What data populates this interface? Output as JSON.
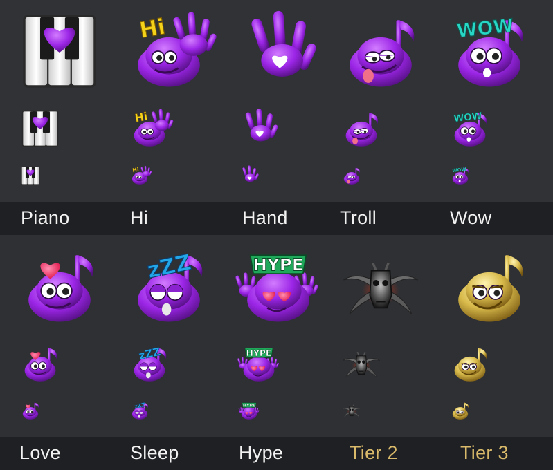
{
  "rows": [
    {
      "emotes": [
        {
          "label": "Piano",
          "icon": "piano-heart-icon",
          "tier": "standard"
        },
        {
          "label": "Hi",
          "icon": "hi-wave-icon",
          "tier": "standard"
        },
        {
          "label": "Hand",
          "icon": "hand-heart-icon",
          "tier": "standard"
        },
        {
          "label": "Troll",
          "icon": "troll-note-icon",
          "tier": "standard"
        },
        {
          "label": "Wow",
          "icon": "wow-note-icon",
          "tier": "standard"
        }
      ]
    },
    {
      "emotes": [
        {
          "label": "Love",
          "icon": "love-note-icon",
          "tier": "standard"
        },
        {
          "label": "Sleep",
          "icon": "sleep-note-icon",
          "tier": "standard"
        },
        {
          "label": "Hype",
          "icon": "hype-note-icon",
          "tier": "standard"
        },
        {
          "label": "Tier 2",
          "icon": "skull-horns-icon",
          "tier": "gold"
        },
        {
          "label": "Tier 3",
          "icon": "golden-note-icon",
          "tier": "gold"
        }
      ]
    }
  ],
  "overlay_text": {
    "hi": "Hi",
    "wow": "WOW",
    "zzz": "zZZ",
    "hype": "HYPE"
  },
  "colors": {
    "background": "#2c2d31",
    "label_bar": "#1f2023",
    "label_text": "#f2f2f2",
    "tier_label": "#d9ba6a",
    "purple": "#8b1fd6",
    "yellow_text": "#f5d21a",
    "teal_text": "#28d6c6"
  }
}
